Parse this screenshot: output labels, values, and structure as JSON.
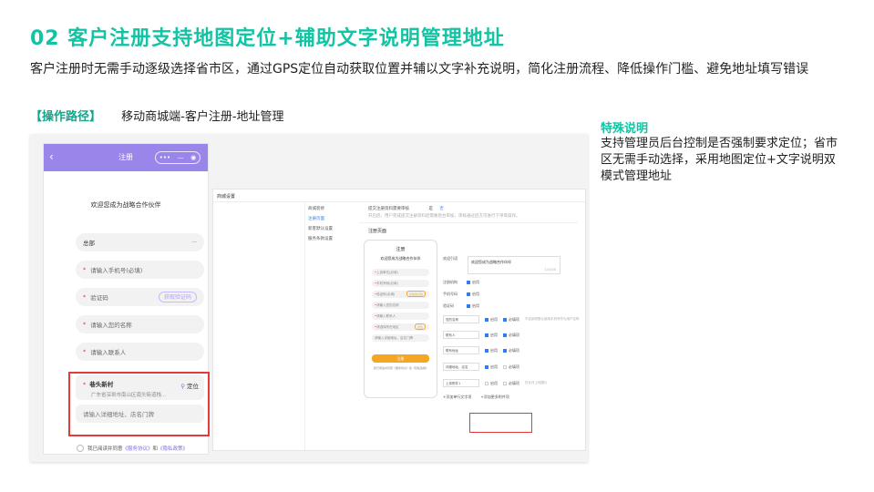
{
  "header": {
    "title": "02  客户注册支持地图定位+辅助文字说明管理地址",
    "description": "客户注册时无需手动逐级选择省市区，通过GPS定位自动获取位置并辅以文字补充说明，简化注册流程、降低操作门槛、避免地址填写错误",
    "path_tag": "【操作路径】",
    "path_value": "移动商城端-客户注册-地址管理"
  },
  "note": {
    "title": "特殊说明",
    "body": "支持管理员后台控制是否强制要求定位；省市区无需手动选择，采用地图定位+文字说明双模式管理地址"
  },
  "phone": {
    "back_icon": "‹",
    "title": "注册",
    "capsule_more": "•••",
    "capsule_min": "—",
    "capsule_close": "◉",
    "welcome": "欢迎您成为战略合作伙伴",
    "hq": "总部",
    "hq_more": "···",
    "fields": [
      {
        "star": "*",
        "label": "请输入手机号(必填)"
      },
      {
        "star": "*",
        "label": "验证码",
        "button": "获取验证码"
      },
      {
        "star": "*",
        "label": "请输入您的名称"
      },
      {
        "star": "*",
        "label": "请输入联系人"
      }
    ],
    "address": {
      "star": "*",
      "name": "巷头新村",
      "detail": "广东省深圳市南山区南头街道栈...",
      "locate": "定位",
      "detail_placeholder": "请输入详细地址、店名门牌"
    },
    "agree_prefix": "我已阅读并同意",
    "agree_service": "《服务协议》",
    "agree_and": "和",
    "agree_privacy": "《隐私政策》"
  },
  "admin": {
    "title": "商城设置",
    "menu": [
      "商城装修",
      "注册页面",
      "新客默认设置",
      "服务条款设置"
    ],
    "top_label": "提交注册资料需要审核",
    "top_yes": "是",
    "top_no": "否",
    "top_hint": "开启后，用户完成提交注册资料后需要后台审核，审核通过后方可进行下单等操作。",
    "section": "注册页面",
    "mini": {
      "title": "注册",
      "welcome": "欢迎您成为战略合作伙伴",
      "fields": [
        "上游单位(必填)",
        "手机号码(必填)",
        "验证码(必填)",
        "请输入您的名称",
        "请输入联系人",
        "请选择所在地区",
        "请输入详细地址、店名门牌"
      ],
      "sms": "获取验证码",
      "locate": "定位",
      "button": "注册",
      "agree": "我已阅读并同意《服务协议》和《隐私政策》"
    },
    "welcome_label": "欢迎引语",
    "welcome_value": "欢迎您成为战略合作伙伴",
    "welcome_count": "11/100",
    "rows": [
      {
        "label": "注册机构",
        "opt": "启用"
      },
      {
        "label": "手机号码",
        "opt": "启用"
      },
      {
        "label": "验证码",
        "opt": "启用"
      }
    ],
    "inputs": [
      {
        "label": "您的名称",
        "o1": "启用",
        "o2": "必填项",
        "hint": "不启用则默认使用手机号作为用户名称"
      },
      {
        "label": "联系人",
        "o1": "启用",
        "o2": "必填项",
        "hint": ""
      },
      {
        "label": "联系地址",
        "o1": "启用",
        "o2": "必填项",
        "hint": ""
      },
      {
        "label": "详细地址、店名",
        "o1": "启用",
        "o2": "必填项",
        "hint": ""
      },
      {
        "label": "上传附件1",
        "o1": "启用",
        "o2": "必填项",
        "hint": "仅允许上传图片"
      }
    ],
    "add_single": "+添加单行文字项",
    "add_file": "+添加更多附件项"
  }
}
